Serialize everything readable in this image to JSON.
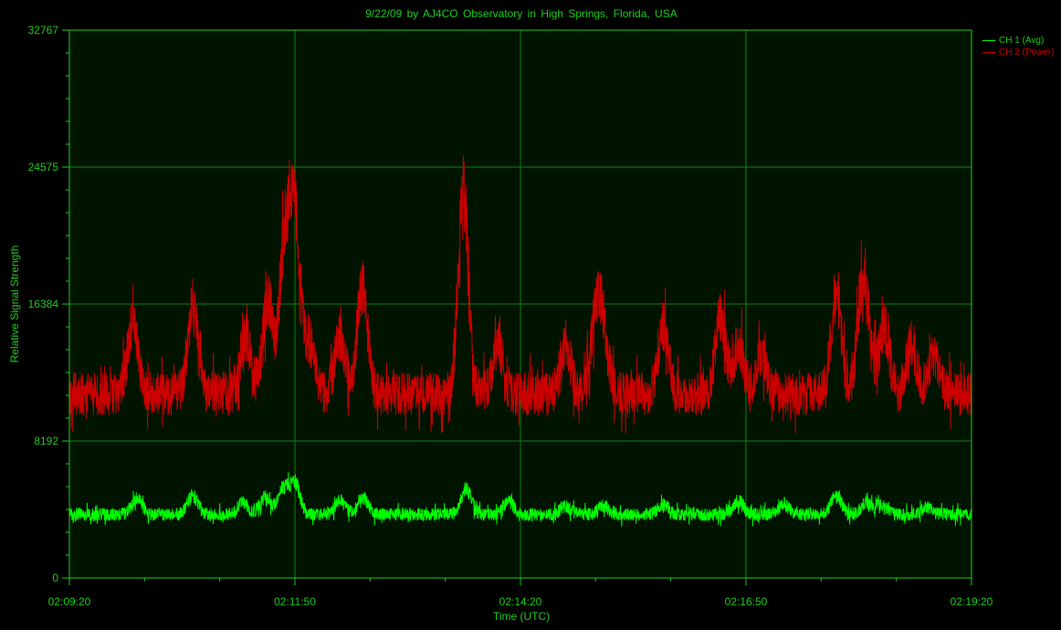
{
  "chart_data": {
    "type": "line",
    "title": "9/22/09  by  AJ4CO Observatory  in  High Springs, Florida, USA",
    "xlabel": "Time (UTC)",
    "ylabel": "Relative Signal Strength",
    "x_tick_labels": [
      "02:09:20",
      "02:11:50",
      "02:14:20",
      "02:16:50",
      "02:19:20"
    ],
    "x_range_seconds": [
      0,
      600
    ],
    "y_ticks": [
      0,
      8192,
      16384,
      24575,
      32767
    ],
    "ylim": [
      0,
      32767
    ],
    "grid": true,
    "legend_position": "top-right",
    "background_color": "#001400",
    "grid_color": "#138013",
    "text_color": "#1ecf1e",
    "series": [
      {
        "name": "CH 1 (Avg)",
        "color": "#00ff00",
        "base_level": 3800,
        "noise_amplitude": 380,
        "peaks": [
          {
            "t": 45,
            "height": 900
          },
          {
            "t": 82,
            "height": 1100
          },
          {
            "t": 115,
            "height": 700
          },
          {
            "t": 130,
            "height": 1000
          },
          {
            "t": 142,
            "height": 1500
          },
          {
            "t": 150,
            "height": 1800
          },
          {
            "t": 180,
            "height": 800
          },
          {
            "t": 195,
            "height": 1000
          },
          {
            "t": 264,
            "height": 1500
          },
          {
            "t": 292,
            "height": 800
          },
          {
            "t": 330,
            "height": 500
          },
          {
            "t": 355,
            "height": 500
          },
          {
            "t": 395,
            "height": 600
          },
          {
            "t": 445,
            "height": 800
          },
          {
            "t": 475,
            "height": 600
          },
          {
            "t": 510,
            "height": 1100
          },
          {
            "t": 530,
            "height": 700
          },
          {
            "t": 540,
            "height": 600
          },
          {
            "t": 570,
            "height": 400
          }
        ]
      },
      {
        "name": "CH 2 (Power)",
        "color": "#cc0000",
        "base_level": 11000,
        "noise_amplitude": 1300,
        "peaks": [
          {
            "t": 42,
            "height": 4000
          },
          {
            "t": 82,
            "height": 5000
          },
          {
            "t": 117,
            "height": 3500
          },
          {
            "t": 132,
            "height": 5500
          },
          {
            "t": 143,
            "height": 8500
          },
          {
            "t": 150,
            "height": 10500
          },
          {
            "t": 160,
            "height": 3000
          },
          {
            "t": 180,
            "height": 3500
          },
          {
            "t": 195,
            "height": 6500
          },
          {
            "t": 262,
            "height": 12000
          },
          {
            "t": 285,
            "height": 3000
          },
          {
            "t": 330,
            "height": 3000
          },
          {
            "t": 350,
            "height": 4000
          },
          {
            "t": 355,
            "height": 3500
          },
          {
            "t": 395,
            "height": 4000
          },
          {
            "t": 433,
            "height": 4500
          },
          {
            "t": 445,
            "height": 3000
          },
          {
            "t": 460,
            "height": 2500
          },
          {
            "t": 510,
            "height": 6000
          },
          {
            "t": 527,
            "height": 4500
          },
          {
            "t": 530,
            "height": 3500
          },
          {
            "t": 542,
            "height": 4000
          },
          {
            "t": 560,
            "height": 3000
          },
          {
            "t": 575,
            "height": 2500
          }
        ]
      }
    ]
  }
}
